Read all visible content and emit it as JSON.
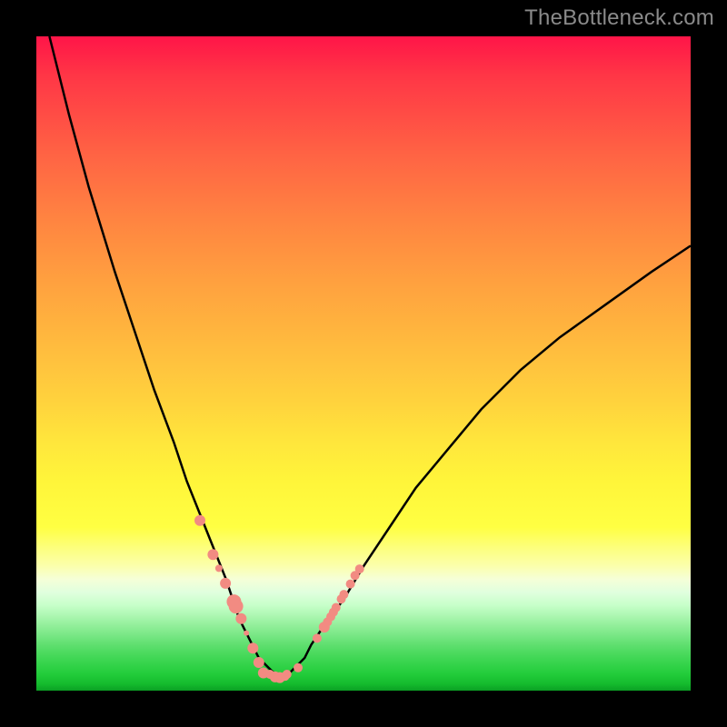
{
  "watermark": "TheBottleneck.com",
  "marker_color": "#f28b82",
  "curve_color": "#000000",
  "chart_data": {
    "type": "line",
    "title": "",
    "xlabel": "",
    "ylabel": "",
    "xlim": [
      0,
      100
    ],
    "ylim": [
      0,
      100
    ],
    "series": [
      {
        "name": "left-arm",
        "x": [
          2,
          5,
          8,
          12,
          15,
          18,
          21,
          23,
          25,
          27,
          29,
          30,
          31,
          32,
          33,
          34,
          35,
          36,
          37
        ],
        "y": [
          100,
          88,
          77,
          64,
          55,
          46,
          38,
          32,
          27,
          22,
          17,
          14,
          11,
          9,
          7,
          5,
          4,
          3,
          2
        ]
      },
      {
        "name": "right-arm",
        "x": [
          37,
          38,
          39,
          40,
          41,
          42,
          44,
          47,
          50,
          54,
          58,
          63,
          68,
          74,
          80,
          87,
          94,
          100
        ],
        "y": [
          2,
          2,
          3,
          4,
          5,
          7,
          10,
          14,
          19,
          25,
          31,
          37,
          43,
          49,
          54,
          59,
          64,
          68
        ]
      }
    ],
    "markers_left": {
      "x": [
        25.0,
        27.0,
        27.9,
        28.9,
        30.2,
        30.5,
        31.3,
        32.1,
        33.1,
        34.0
      ],
      "y": [
        26.0,
        20.8,
        18.7,
        16.4,
        13.6,
        12.9,
        11.0,
        8.8,
        6.5,
        4.3
      ],
      "r": [
        6,
        6,
        4,
        6,
        8,
        8,
        6,
        3,
        6,
        6
      ]
    },
    "markers_right": {
      "x": [
        35.7,
        38.3,
        40.0,
        42.9,
        44.0,
        44.5,
        45.0,
        45.4,
        45.8,
        46.6,
        47.0,
        48.0,
        48.7,
        49.4
      ],
      "y": [
        2.5,
        2.5,
        3.5,
        8.0,
        9.7,
        10.5,
        11.3,
        12.0,
        12.7,
        14.0,
        14.7,
        16.3,
        17.6,
        18.6
      ],
      "r": [
        5,
        5,
        5,
        5,
        6,
        5,
        5,
        5,
        5,
        5,
        5,
        5,
        5,
        5
      ]
    },
    "markers_bottom": {
      "x": [
        34.7,
        36.5,
        37.2,
        38.0
      ],
      "y": [
        2.7,
        2.1,
        2.0,
        2.2
      ],
      "r": [
        6,
        6,
        6,
        5
      ]
    }
  }
}
